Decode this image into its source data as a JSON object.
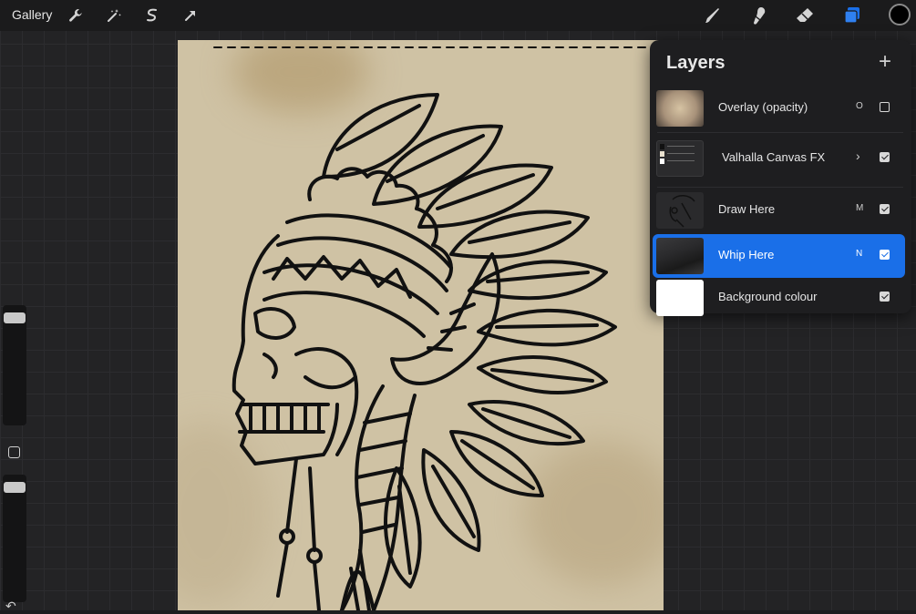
{
  "app": {
    "gallery_label": "Gallery"
  },
  "toolbar": {
    "left_tools": [
      {
        "name": "wrench-icon",
        "label": "Actions"
      },
      {
        "name": "magic-wand-icon",
        "label": "Adjustments"
      },
      {
        "name": "selection-icon",
        "label": "Selection"
      },
      {
        "name": "transform-arrow-icon",
        "label": "Transform"
      }
    ],
    "right_tools": [
      {
        "name": "brush-icon"
      },
      {
        "name": "smudge-icon"
      },
      {
        "name": "eraser-icon"
      },
      {
        "name": "layers-icon",
        "active_color": "#1a6fe8"
      }
    ],
    "current_color": "#000000"
  },
  "layers_panel": {
    "title": "Layers",
    "add_symbol": "+",
    "layers": [
      {
        "name": "Overlay (opacity)",
        "mode": "O",
        "visible": false,
        "thumb": "overlay"
      },
      {
        "name": "Valhalla Canvas FX",
        "mode": "›",
        "visible": true,
        "thumb": "group"
      },
      {
        "name": "Draw Here",
        "mode": "M",
        "visible": true,
        "thumb": "drawing"
      },
      {
        "name": "Whip Here",
        "mode": "N",
        "visible": true,
        "thumb": "whip",
        "selected": true
      },
      {
        "name": "Background colour",
        "mode": "",
        "visible": true,
        "thumb": "white"
      }
    ]
  },
  "colors": {
    "accent": "#1a6fe8",
    "paper": "#cfc2a4",
    "ink": "#111111"
  }
}
